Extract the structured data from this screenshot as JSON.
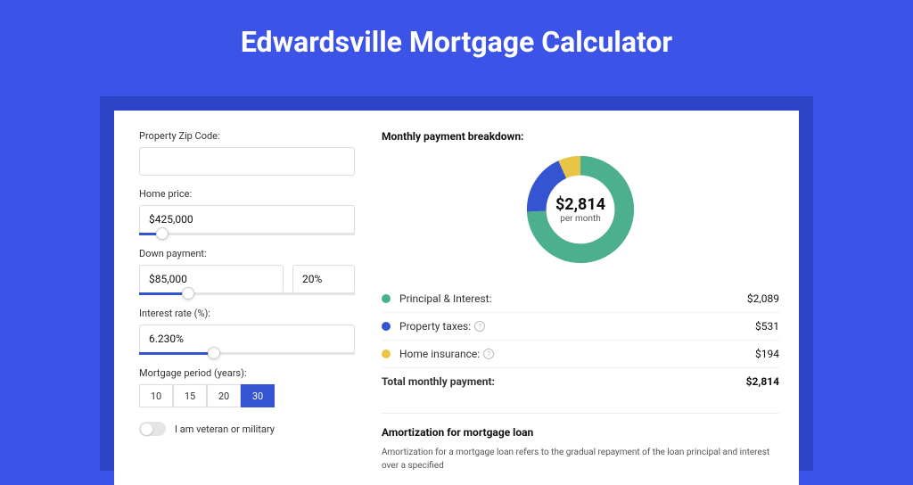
{
  "title": "Edwardsville Mortgage Calculator",
  "form": {
    "zip_label": "Property Zip Code:",
    "zip_value": "",
    "price_label": "Home price:",
    "price_value": "$425,000",
    "price_slider_pct": 8,
    "down_label": "Down payment:",
    "down_value": "$85,000",
    "down_pct_value": "20%",
    "down_slider_pct": 20,
    "rate_label": "Interest rate (%):",
    "rate_value": "6.230%",
    "rate_slider_pct": 32,
    "period_label": "Mortgage period (years):",
    "periods": [
      "10",
      "15",
      "20",
      "30"
    ],
    "period_selected": "30",
    "veteran_label": "I am veteran or military"
  },
  "breakdown": {
    "header": "Monthly payment breakdown:",
    "total_amount": "$2,814",
    "per_month": "per month",
    "items": [
      {
        "label": "Principal & Interest:",
        "value": "$2,089",
        "color": "#4CAF8E",
        "info": false
      },
      {
        "label": "Property taxes:",
        "value": "$531",
        "color": "#3454d1",
        "info": true
      },
      {
        "label": "Home insurance:",
        "value": "$194",
        "color": "#E8C547",
        "info": true
      }
    ],
    "total_label": "Total monthly payment:",
    "total_value": "$2,814"
  },
  "amort": {
    "header": "Amortization for mortgage loan",
    "text": "Amortization for a mortgage loan refers to the gradual repayment of the loan principal and interest over a specified"
  },
  "chart_data": {
    "type": "pie",
    "title": "Monthly payment breakdown",
    "categories": [
      "Principal & Interest",
      "Property taxes",
      "Home insurance"
    ],
    "values": [
      2089,
      531,
      194
    ],
    "colors": [
      "#4CAF8E",
      "#3454d1",
      "#E8C547"
    ],
    "total": 2814
  }
}
